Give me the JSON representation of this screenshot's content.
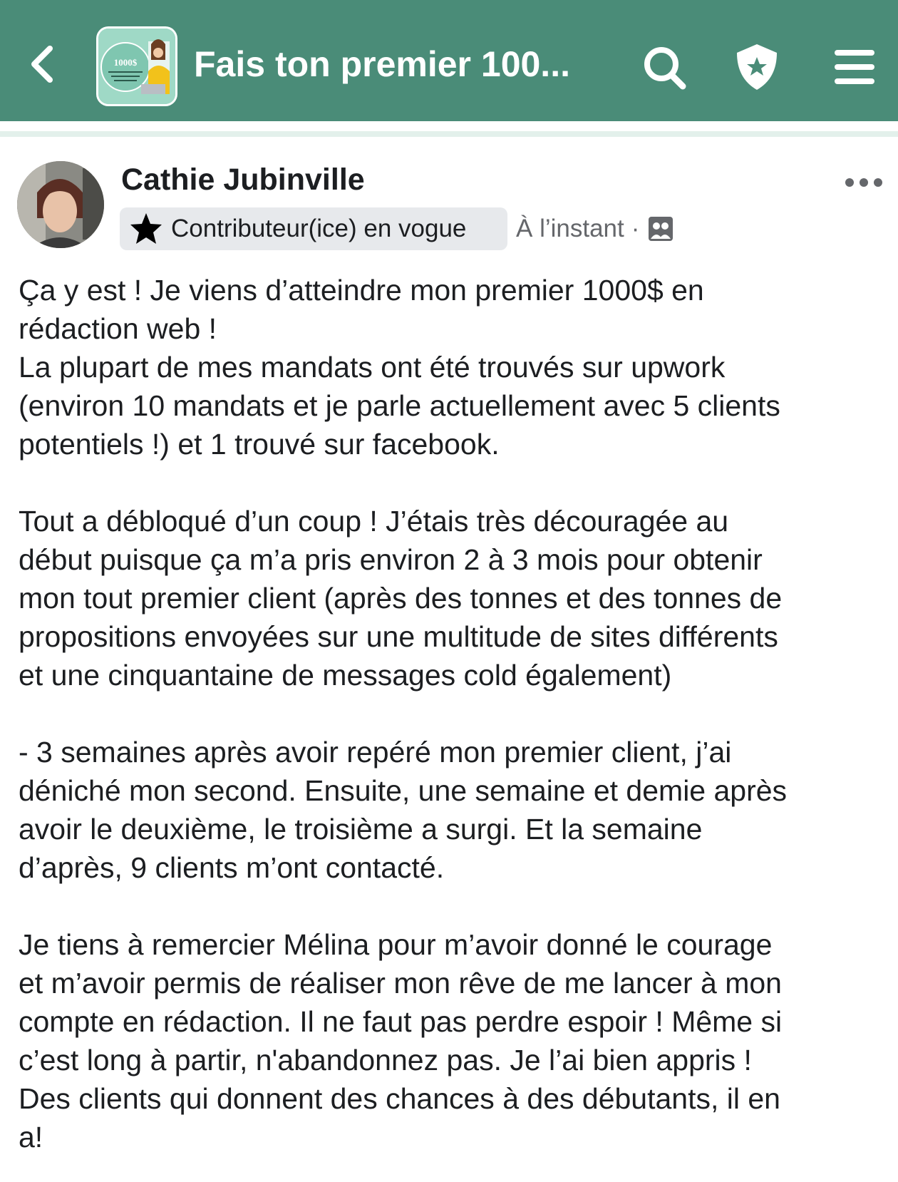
{
  "header": {
    "group_title": "Fais ton premier 100...",
    "thumb_text": "1000$",
    "icons": [
      "back-chevron-icon",
      "search-icon",
      "shield-star-icon",
      "hamburger-menu-icon"
    ],
    "bar_color": "#4a8c78"
  },
  "post": {
    "author": "Cathie Jubinville",
    "badge": "Contributeur(ice) en vogue",
    "time": "À l’instant",
    "dot": "·",
    "paragraphs": [
      {
        "lines": [
          "Ça y est ! Je viens d’atteindre mon premier 1000$ en",
          "rédaction web !",
          "La plupart de mes mandats ont été trouvés sur upwork",
          "(environ 10 mandats et je parle actuellement avec 5 clients",
          "potentiels !) et 1 trouvé sur facebook."
        ]
      },
      {
        "lines": [
          "Tout a débloqué d’un coup ! J’étais très découragée au",
          "début puisque ça m’a pris environ 2 à 3 mois pour obtenir",
          "mon tout premier client (après des tonnes et des tonnes de",
          "propositions envoyées sur une multitude de sites différents",
          "et une cinquantaine de messages cold également)"
        ]
      },
      {
        "lines": [
          "- 3 semaines après avoir repéré mon premier client, j’ai",
          "déniché mon second. Ensuite, une semaine et demie après",
          "avoir le deuxième, le troisième a surgi. Et la semaine",
          "d’après, 9 clients m’ont contacté."
        ]
      },
      {
        "lines": [
          "Je tiens à remercier Mélina pour m’avoir donné le courage",
          "et m’avoir permis de réaliser mon rêve de me lancer à mon",
          "compte en rédaction. Il ne faut pas perdre espoir ! Même si",
          "c’est long à partir, n'abandonnez pas. Je l’ai bien appris !",
          "Des clients qui donnent des chances à des débutants, il en",
          "a!"
        ]
      }
    ]
  }
}
